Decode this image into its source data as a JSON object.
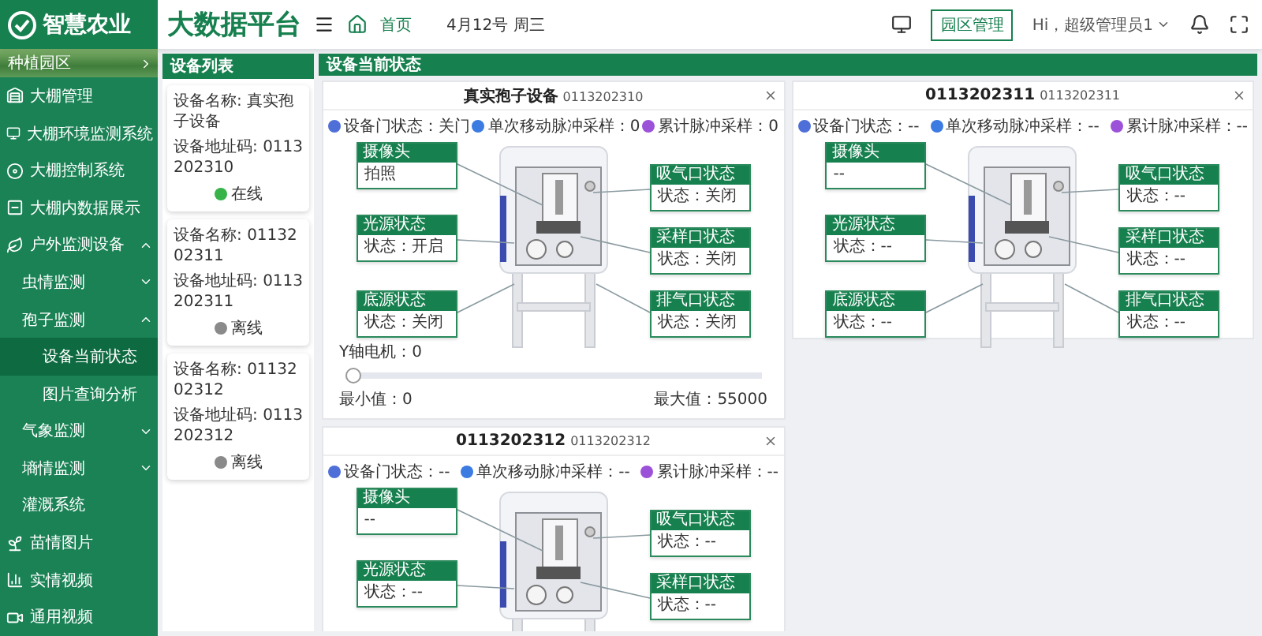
{
  "header": {
    "brand": "智慧农业",
    "platform": "大数据平台",
    "breadcrumb": "首页",
    "date": "4月12号 周三",
    "park_button": "园区管理",
    "user": "Hi，超级管理员1"
  },
  "sidebar": {
    "banner": "种植园区",
    "items": [
      {
        "label": "大棚管理",
        "selected": false
      },
      {
        "label": "大棚环境监测系统",
        "selected": false
      },
      {
        "label": "大棚控制系统",
        "selected": false
      },
      {
        "label": "大棚内数据展示",
        "selected": false
      },
      {
        "label": "户外监测设备",
        "selected": false,
        "expanded": true,
        "children": [
          {
            "label": "虫情监测",
            "selected": false,
            "expanded": false
          },
          {
            "label": "孢子监测",
            "selected": false,
            "expanded": true,
            "children": [
              {
                "label": "设备当前状态",
                "selected": true
              },
              {
                "label": "图片查询分析",
                "selected": false
              }
            ]
          },
          {
            "label": "气象监测",
            "selected": false,
            "expanded": false
          },
          {
            "label": "墒情监测",
            "selected": false,
            "expanded": false
          },
          {
            "label": "灌溉系统",
            "selected": false
          }
        ]
      },
      {
        "label": "苗情图片",
        "selected": false
      },
      {
        "label": "实情视频",
        "selected": false
      },
      {
        "label": "通用视频",
        "selected": false
      }
    ]
  },
  "device_list": {
    "title": "设备列表",
    "devices": [
      {
        "name_label": "设备名称:",
        "name": "真实孢子设备",
        "address_label": "设备地址码:",
        "address": "0113202310",
        "status": "在线",
        "online": true
      },
      {
        "name_label": "设备名称:",
        "name": "0113202311",
        "address_label": "设备地址码:",
        "address": "0113202311",
        "status": "离线",
        "online": false
      },
      {
        "name_label": "设备名称:",
        "name": "0113202312",
        "address_label": "设备地址码:",
        "address": "0113202312",
        "status": "离线",
        "online": false
      }
    ]
  },
  "status_panel": {
    "title": "设备当前状态",
    "cards": [
      {
        "name": "真实孢子设备",
        "address": "0113202310",
        "metrics": [
          {
            "label": "设备门状态：",
            "value": "关门",
            "color": "#4f6fd8"
          },
          {
            "label": "单次移动脉冲采样：",
            "value": "0",
            "color": "#3b7be2"
          },
          {
            "label": "累计脉冲采样：",
            "value": "0",
            "color": "#9c52d8"
          }
        ],
        "parts": [
          {
            "title": "摄像头",
            "text": "拍照"
          },
          {
            "title": "吸气口状态",
            "text": "状态：关闭"
          },
          {
            "title": "光源状态",
            "text": "状态：开启"
          },
          {
            "title": "采样口状态",
            "text": "状态：关闭"
          },
          {
            "title": "底源状态",
            "text": "状态：关闭"
          },
          {
            "title": "排气口状态",
            "text": "状态：关闭"
          }
        ],
        "slider": {
          "label": "Y轴电机：0",
          "level": 0,
          "min": "最小值：0",
          "max": "最大值：55000"
        }
      },
      {
        "name": "0113202311",
        "address": "0113202311",
        "metrics": [
          {
            "label": "设备门状态：",
            "value": "--",
            "color": "#4f6fd8"
          },
          {
            "label": "单次移动脉冲采样：",
            "value": "--",
            "color": "#3b7be2"
          },
          {
            "label": "累计脉冲采样：",
            "value": "--",
            "color": "#9c52d8"
          }
        ],
        "parts": [
          {
            "title": "摄像头",
            "text": "--"
          },
          {
            "title": "吸气口状态",
            "text": "状态：--"
          },
          {
            "title": "光源状态",
            "text": "状态：--"
          },
          {
            "title": "采样口状态",
            "text": "状态：--"
          },
          {
            "title": "底源状态",
            "text": "状态：--"
          },
          {
            "title": "排气口状态",
            "text": "状态：--"
          }
        ]
      },
      {
        "name": "0113202312",
        "address": "0113202312",
        "metrics": [
          {
            "label": "设备门状态：",
            "value": "--",
            "color": "#4f6fd8"
          },
          {
            "label": "单次移动脉冲采样：",
            "value": "--",
            "color": "#3b7be2"
          },
          {
            "label": "累计脉冲采样：",
            "value": "--",
            "color": "#9c52d8"
          }
        ],
        "parts": [
          {
            "title": "摄像头",
            "text": "--"
          },
          {
            "title": "吸气口状态",
            "text": "状态：--"
          },
          {
            "title": "光源状态",
            "text": "状态：--"
          },
          {
            "title": "采样口状态",
            "text": "状态：--"
          }
        ]
      }
    ]
  }
}
